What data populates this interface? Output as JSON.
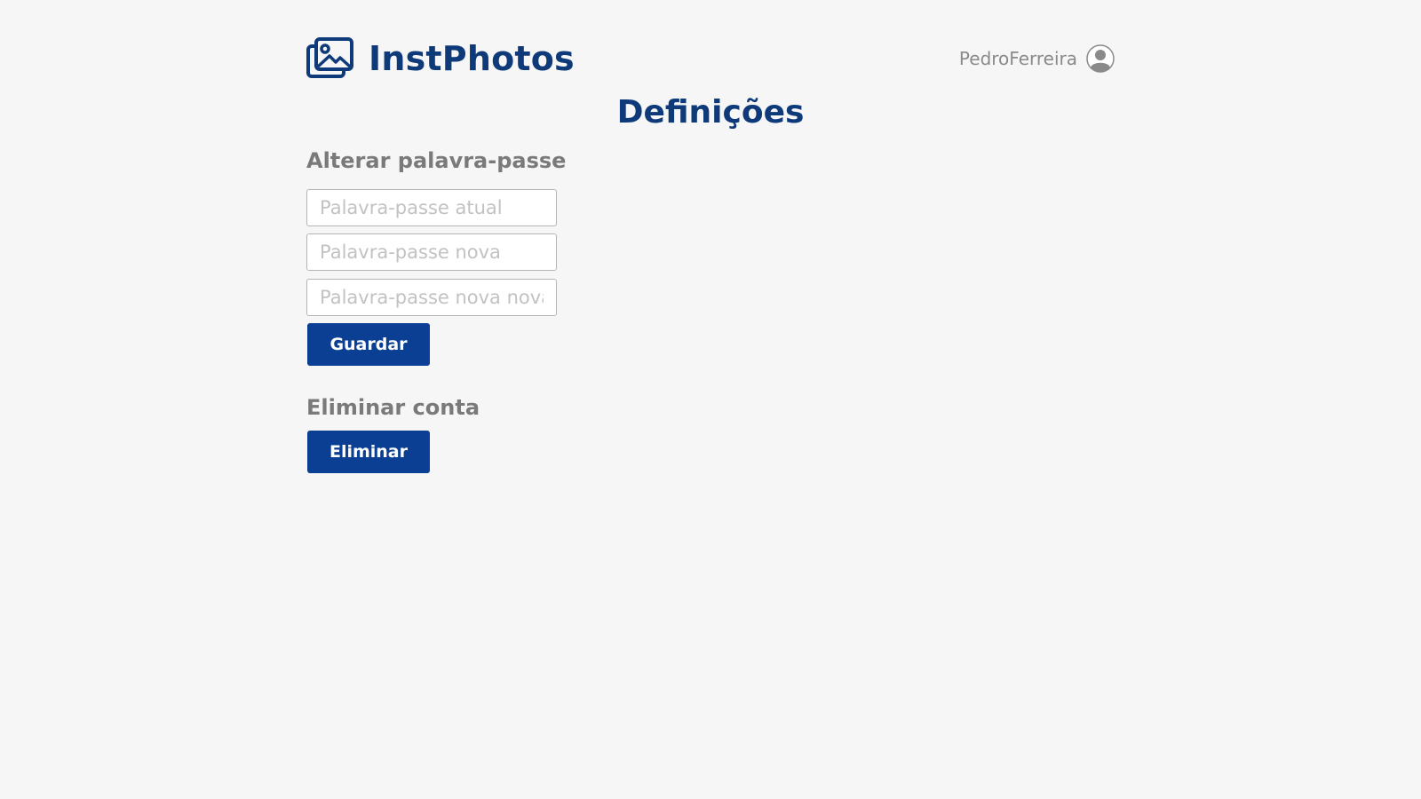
{
  "header": {
    "brand_name": "InstPhotos",
    "logo_icon": "images-icon",
    "username": "PedroFerreira",
    "avatar_icon": "user-avatar-icon"
  },
  "page": {
    "title": "Definições"
  },
  "change_password": {
    "title": "Alterar palavra-passe",
    "current_placeholder": "Palavra-passe atual",
    "new_placeholder": "Palavra-passe nova",
    "confirm_placeholder": "Palavra-passe nova novamente",
    "save_label": "Guardar"
  },
  "delete_account": {
    "title": "Eliminar conta",
    "delete_label": "Eliminar"
  },
  "colors": {
    "brand": "#0f3a7a",
    "button": "#0b3f93",
    "background": "#f6f6f6",
    "section_title": "#7a7a7a"
  }
}
